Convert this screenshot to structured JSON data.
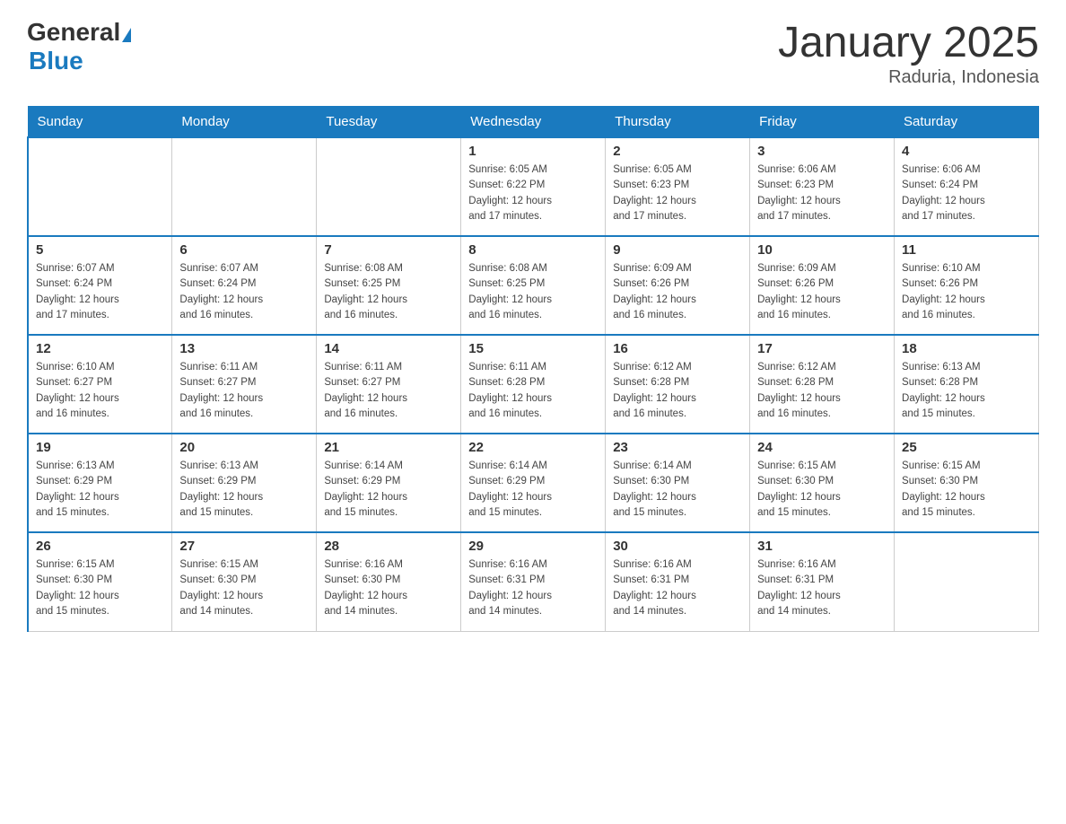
{
  "logo": {
    "general": "General",
    "blue": "Blue"
  },
  "title": "January 2025",
  "subtitle": "Raduria, Indonesia",
  "days_of_week": [
    "Sunday",
    "Monday",
    "Tuesday",
    "Wednesday",
    "Thursday",
    "Friday",
    "Saturday"
  ],
  "weeks": [
    [
      {
        "day": "",
        "info": ""
      },
      {
        "day": "",
        "info": ""
      },
      {
        "day": "",
        "info": ""
      },
      {
        "day": "1",
        "info": "Sunrise: 6:05 AM\nSunset: 6:22 PM\nDaylight: 12 hours\nand 17 minutes."
      },
      {
        "day": "2",
        "info": "Sunrise: 6:05 AM\nSunset: 6:23 PM\nDaylight: 12 hours\nand 17 minutes."
      },
      {
        "day": "3",
        "info": "Sunrise: 6:06 AM\nSunset: 6:23 PM\nDaylight: 12 hours\nand 17 minutes."
      },
      {
        "day": "4",
        "info": "Sunrise: 6:06 AM\nSunset: 6:24 PM\nDaylight: 12 hours\nand 17 minutes."
      }
    ],
    [
      {
        "day": "5",
        "info": "Sunrise: 6:07 AM\nSunset: 6:24 PM\nDaylight: 12 hours\nand 17 minutes."
      },
      {
        "day": "6",
        "info": "Sunrise: 6:07 AM\nSunset: 6:24 PM\nDaylight: 12 hours\nand 16 minutes."
      },
      {
        "day": "7",
        "info": "Sunrise: 6:08 AM\nSunset: 6:25 PM\nDaylight: 12 hours\nand 16 minutes."
      },
      {
        "day": "8",
        "info": "Sunrise: 6:08 AM\nSunset: 6:25 PM\nDaylight: 12 hours\nand 16 minutes."
      },
      {
        "day": "9",
        "info": "Sunrise: 6:09 AM\nSunset: 6:26 PM\nDaylight: 12 hours\nand 16 minutes."
      },
      {
        "day": "10",
        "info": "Sunrise: 6:09 AM\nSunset: 6:26 PM\nDaylight: 12 hours\nand 16 minutes."
      },
      {
        "day": "11",
        "info": "Sunrise: 6:10 AM\nSunset: 6:26 PM\nDaylight: 12 hours\nand 16 minutes."
      }
    ],
    [
      {
        "day": "12",
        "info": "Sunrise: 6:10 AM\nSunset: 6:27 PM\nDaylight: 12 hours\nand 16 minutes."
      },
      {
        "day": "13",
        "info": "Sunrise: 6:11 AM\nSunset: 6:27 PM\nDaylight: 12 hours\nand 16 minutes."
      },
      {
        "day": "14",
        "info": "Sunrise: 6:11 AM\nSunset: 6:27 PM\nDaylight: 12 hours\nand 16 minutes."
      },
      {
        "day": "15",
        "info": "Sunrise: 6:11 AM\nSunset: 6:28 PM\nDaylight: 12 hours\nand 16 minutes."
      },
      {
        "day": "16",
        "info": "Sunrise: 6:12 AM\nSunset: 6:28 PM\nDaylight: 12 hours\nand 16 minutes."
      },
      {
        "day": "17",
        "info": "Sunrise: 6:12 AM\nSunset: 6:28 PM\nDaylight: 12 hours\nand 16 minutes."
      },
      {
        "day": "18",
        "info": "Sunrise: 6:13 AM\nSunset: 6:28 PM\nDaylight: 12 hours\nand 15 minutes."
      }
    ],
    [
      {
        "day": "19",
        "info": "Sunrise: 6:13 AM\nSunset: 6:29 PM\nDaylight: 12 hours\nand 15 minutes."
      },
      {
        "day": "20",
        "info": "Sunrise: 6:13 AM\nSunset: 6:29 PM\nDaylight: 12 hours\nand 15 minutes."
      },
      {
        "day": "21",
        "info": "Sunrise: 6:14 AM\nSunset: 6:29 PM\nDaylight: 12 hours\nand 15 minutes."
      },
      {
        "day": "22",
        "info": "Sunrise: 6:14 AM\nSunset: 6:29 PM\nDaylight: 12 hours\nand 15 minutes."
      },
      {
        "day": "23",
        "info": "Sunrise: 6:14 AM\nSunset: 6:30 PM\nDaylight: 12 hours\nand 15 minutes."
      },
      {
        "day": "24",
        "info": "Sunrise: 6:15 AM\nSunset: 6:30 PM\nDaylight: 12 hours\nand 15 minutes."
      },
      {
        "day": "25",
        "info": "Sunrise: 6:15 AM\nSunset: 6:30 PM\nDaylight: 12 hours\nand 15 minutes."
      }
    ],
    [
      {
        "day": "26",
        "info": "Sunrise: 6:15 AM\nSunset: 6:30 PM\nDaylight: 12 hours\nand 15 minutes."
      },
      {
        "day": "27",
        "info": "Sunrise: 6:15 AM\nSunset: 6:30 PM\nDaylight: 12 hours\nand 14 minutes."
      },
      {
        "day": "28",
        "info": "Sunrise: 6:16 AM\nSunset: 6:30 PM\nDaylight: 12 hours\nand 14 minutes."
      },
      {
        "day": "29",
        "info": "Sunrise: 6:16 AM\nSunset: 6:31 PM\nDaylight: 12 hours\nand 14 minutes."
      },
      {
        "day": "30",
        "info": "Sunrise: 6:16 AM\nSunset: 6:31 PM\nDaylight: 12 hours\nand 14 minutes."
      },
      {
        "day": "31",
        "info": "Sunrise: 6:16 AM\nSunset: 6:31 PM\nDaylight: 12 hours\nand 14 minutes."
      },
      {
        "day": "",
        "info": ""
      }
    ]
  ]
}
